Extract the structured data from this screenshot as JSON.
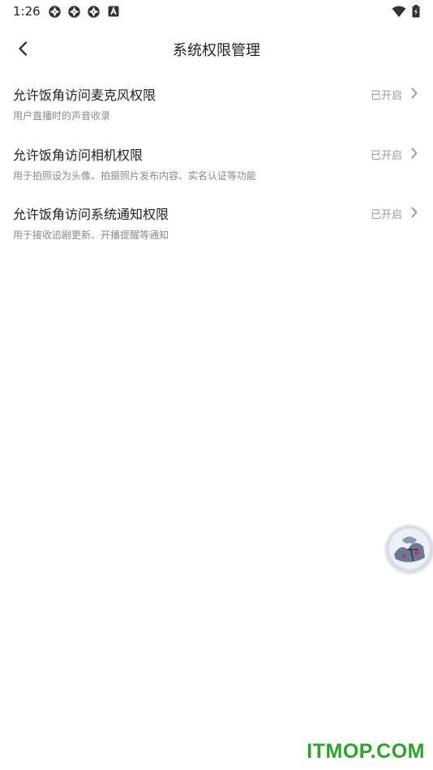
{
  "status_bar": {
    "time": "1:26",
    "left_icons": [
      "aperture-icon",
      "aperture-icon",
      "aperture-icon",
      "a-box-icon"
    ],
    "right_icons": [
      "wifi-icon",
      "battery-charging-icon"
    ]
  },
  "header": {
    "title": "系统权限管理",
    "back_icon": "chevron-left-icon"
  },
  "permissions": [
    {
      "title": "允许饭角访问麦克风权限",
      "description": "用户直播时的声音收录",
      "status": "已开启"
    },
    {
      "title": "允许饭角访问相机权限",
      "description": "用于拍照设为头像、拍摄照片发布内容、实名认证等功能",
      "status": "已开启"
    },
    {
      "title": "允许饭角访问系统通知权限",
      "description": "用于接收追剧更新、开播提醒等通知",
      "status": "已开启"
    }
  ],
  "floating_button": {
    "icon": "floating-avatar-icon"
  },
  "watermark": {
    "text": "ITMOP.COM",
    "color": "#2aa52a"
  },
  "colors": {
    "text_primary": "#222222",
    "text_secondary": "#8a8a8a",
    "status": "#9a9a9a"
  }
}
